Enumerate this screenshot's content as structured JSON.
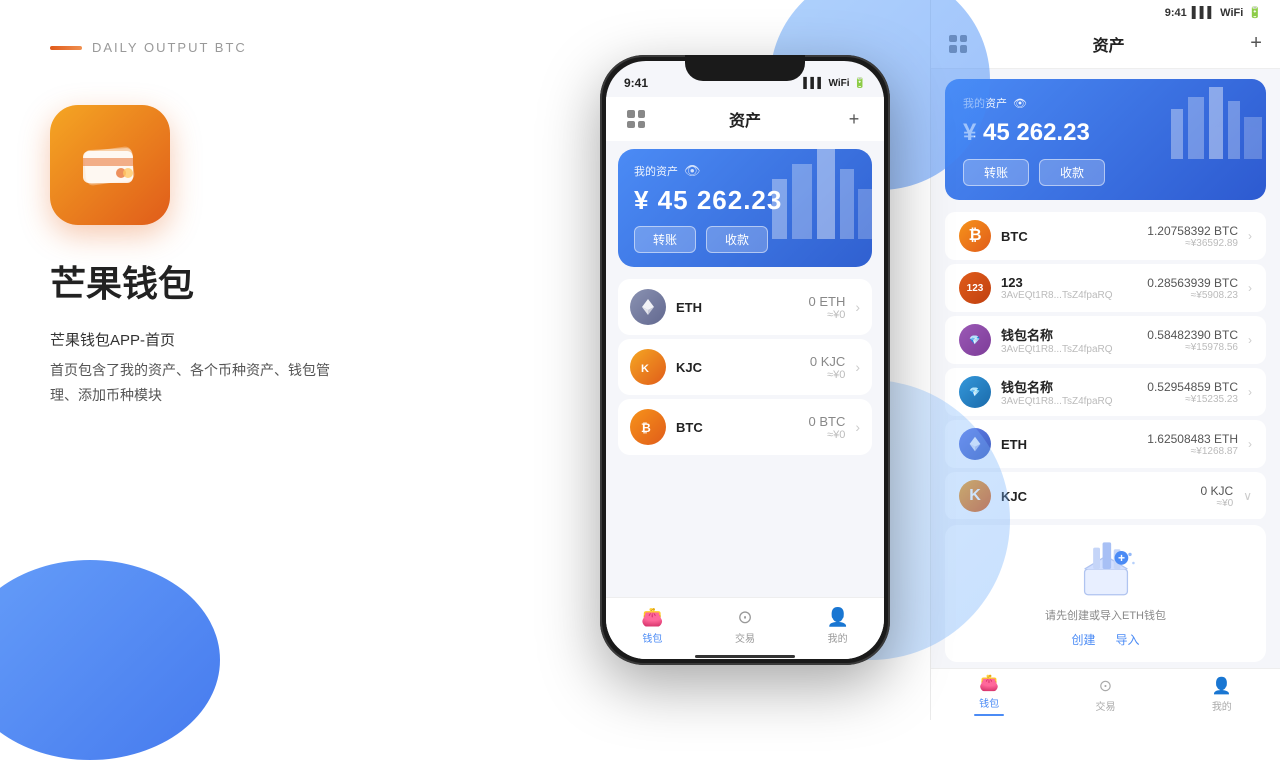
{
  "left": {
    "brand_line_visible": true,
    "app_name": "芒果钱包",
    "app_subtitle": "DAILY OUTPUT BTC",
    "app_desc_title": "芒果钱包APP-首页",
    "app_desc": "首页包含了我的资产、各个币种资产、钱包管\n理、添加币种模块"
  },
  "phone": {
    "status_time": "9:41",
    "nav_title": "资产",
    "nav_add": "+",
    "asset_label": "我的资产",
    "asset_amount": "¥ 45 262.23",
    "transfer_btn": "转账",
    "receive_btn": "收款",
    "coins": [
      {
        "id": "eth",
        "name": "ETH",
        "amount": "0 ETH",
        "approx": "≈¥0",
        "color": "eth"
      },
      {
        "id": "kjc",
        "name": "KJC",
        "amount": "0 KJC",
        "approx": "≈¥0",
        "color": "kjc"
      },
      {
        "id": "btc",
        "name": "BTC",
        "amount": "0 BTC",
        "approx": "≈¥0",
        "color": "btc"
      }
    ],
    "tabs": [
      {
        "id": "wallet",
        "label": "钱包",
        "active": true
      },
      {
        "id": "trade",
        "label": "交易",
        "active": false
      },
      {
        "id": "mine",
        "label": "我的",
        "active": false
      }
    ]
  },
  "right": {
    "status_time": "9:41",
    "nav_title": "资产",
    "nav_add": "+",
    "asset_label": "我的资产",
    "asset_amount": "¥ 45 262.23",
    "transfer_btn": "转账",
    "receive_btn": "收款",
    "coins": [
      {
        "id": "btc",
        "type": "btc",
        "name": "BTC",
        "addr": "",
        "amount": "1.20758392 BTC",
        "approx": "≈¥36592.89"
      },
      {
        "id": "123",
        "type": "token123",
        "name": "123",
        "addr": "3AvEQt1R8...TsZ4fpaRQ",
        "amount": "0.28563939 BTC",
        "approx": "≈¥5908.23"
      },
      {
        "id": "wallet1",
        "type": "purple",
        "name": "钱包名称",
        "addr": "3AvEQt1R8...TsZ4fpaRQ",
        "amount": "0.58482390 BTC",
        "approx": "≈¥15978.56"
      },
      {
        "id": "wallet2",
        "type": "blue",
        "name": "钱包名称",
        "addr": "3AvEQt1R8...TsZ4fpaRQ",
        "amount": "0.52954859 BTC",
        "approx": "≈¥15235.23"
      },
      {
        "id": "eth",
        "type": "eth",
        "name": "ETH",
        "addr": "",
        "amount": "1.62508483 ETH",
        "approx": "≈¥1268.87"
      },
      {
        "id": "kjc",
        "type": "kjc",
        "name": "KJC",
        "addr": "",
        "amount": "0 KJC",
        "approx": "≈¥0"
      }
    ],
    "eth_prompt_text": "请先创建或导入ETH钱包",
    "create_btn": "创建",
    "import_btn": "导入",
    "tabs": [
      {
        "id": "wallet",
        "label": "钱包",
        "active": true
      },
      {
        "id": "trade",
        "label": "交易",
        "active": false
      },
      {
        "id": "mine",
        "label": "我的",
        "active": false
      }
    ]
  }
}
